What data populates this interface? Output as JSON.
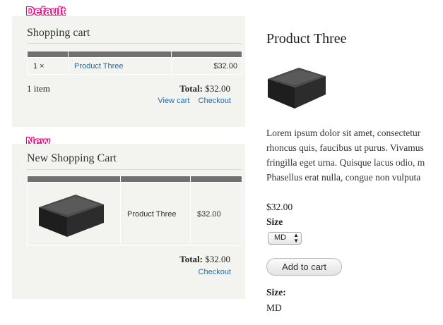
{
  "labels": {
    "default_tag": "Default",
    "new_tag": "New"
  },
  "default_cart": {
    "title": "Shopping cart",
    "row": {
      "qty": "1 ×",
      "product": "Product Three",
      "price": "$32.00"
    },
    "item_count": "1 item",
    "total_label": "Total:",
    "total_value": "$32.00",
    "view_cart": "View cart",
    "checkout": "Checkout"
  },
  "new_cart": {
    "title": "New Shopping Cart",
    "row": {
      "product": "Product Three",
      "price": "$32.00"
    },
    "total_label": "Total:",
    "total_value": "$32.00",
    "checkout": "Checkout"
  },
  "product": {
    "title": "Product Three",
    "description": [
      "Lorem ipsum dolor sit amet, consectetur",
      "rhoncus quis, faucibus ut purus. Vivamus",
      "fringilla eget urna. Quisque lacus odio, m",
      "Phasellus erat nulla, congue non vulputa"
    ],
    "price": "$32.00",
    "size_label": "Size",
    "size_selected": "MD",
    "add_to_cart": "Add to cart",
    "size_summary_label": "Size:",
    "size_summary_value": "MD"
  },
  "colors": {
    "tag": "#e5007d",
    "link": "#1a6fb3",
    "panel": "#f3f3ef",
    "table_header": "#707070"
  }
}
